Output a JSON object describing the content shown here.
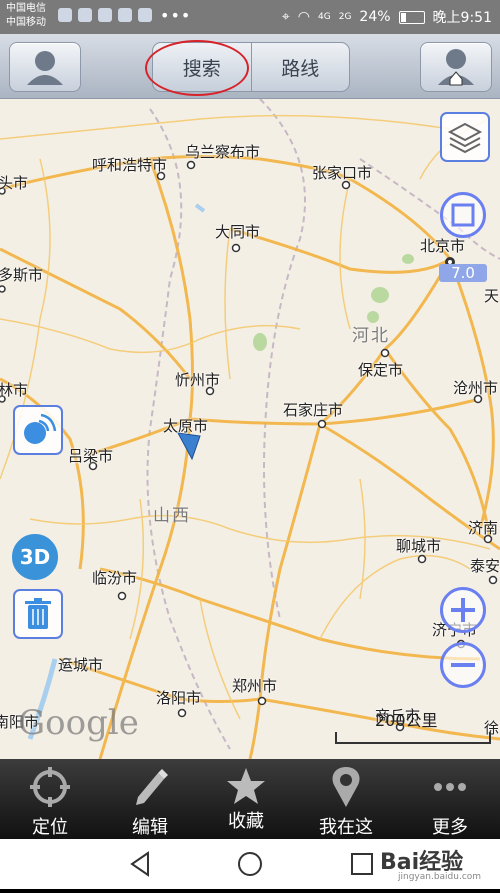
{
  "status": {
    "carrier1": "中国电信",
    "carrier2": "中国移动",
    "dots": "•••",
    "net1": "4G",
    "net2": "2G",
    "battery": "24%",
    "time": "晚上9:51"
  },
  "topbar": {
    "search_tab": "搜索",
    "route_tab": "路线"
  },
  "map": {
    "zoom_level": "7.0",
    "cities": [
      "乌兰察布市",
      "呼和浩特市",
      "张家口市",
      "大同市",
      "北京市",
      "忻州市",
      "保定市",
      "沧州市",
      "太原市",
      "石家庄市",
      "吕梁市",
      "聊城市",
      "济南",
      "泰安",
      "临汾市",
      "运城市",
      "济宁市",
      "郑州市",
      "洛阳市",
      "商丘市"
    ],
    "edge_labels": [
      "头市",
      "多斯市",
      "林市",
      "天",
      "南阳市",
      "徐"
    ],
    "provinces": [
      "河北",
      "山西"
    ],
    "google": "Google",
    "scale_label": "200公里",
    "controls": {
      "compass_icon": "compass-icon",
      "threed_label": "3D"
    }
  },
  "bottom_tabs": [
    {
      "label": "定位",
      "icon": "locate-icon"
    },
    {
      "label": "编辑",
      "icon": "pencil-icon"
    },
    {
      "label": "收藏",
      "icon": "star-icon"
    },
    {
      "label": "我在这",
      "icon": "pin-icon"
    },
    {
      "label": "更多",
      "icon": "more-icon"
    }
  ],
  "watermark": {
    "brand": "Bai经验",
    "url": "jingyan.baidu.com"
  }
}
